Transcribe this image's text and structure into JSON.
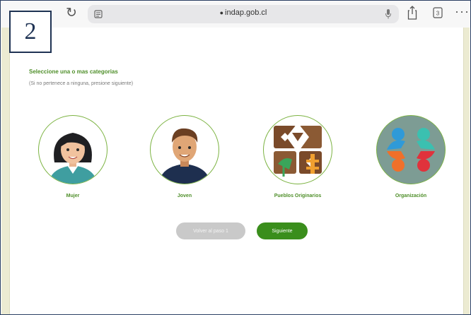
{
  "step_number": "2",
  "browser": {
    "url": "indap.gob.cl",
    "reload_icon": "reload-icon",
    "reader_icon": "reader-icon",
    "mic_icon": "mic-icon",
    "share_icon": "share-icon",
    "tabs_icon": "tabs-icon",
    "tabs_count": "3",
    "more_icon": "more-icon",
    "more_glyph": "···"
  },
  "page": {
    "heading": "Seleccione una o mas categorias",
    "subheading": "(Si no pertenece a ninguna, presione siguiente)",
    "categories": [
      {
        "label": "Mujer",
        "icon": "woman-icon"
      },
      {
        "label": "Joven",
        "icon": "young-man-icon"
      },
      {
        "label": "Pueblos Originarios",
        "icon": "indigenous-peoples-icon"
      },
      {
        "label": "Organización",
        "icon": "organization-icon"
      }
    ],
    "back_button": "Volver al paso 1",
    "next_button": "Siguiente"
  },
  "colors": {
    "accent_green": "#3a8e1c",
    "label_green": "#4f8f2a",
    "disabled_gray": "#c9c9c9",
    "badge_navy": "#1f3354"
  }
}
